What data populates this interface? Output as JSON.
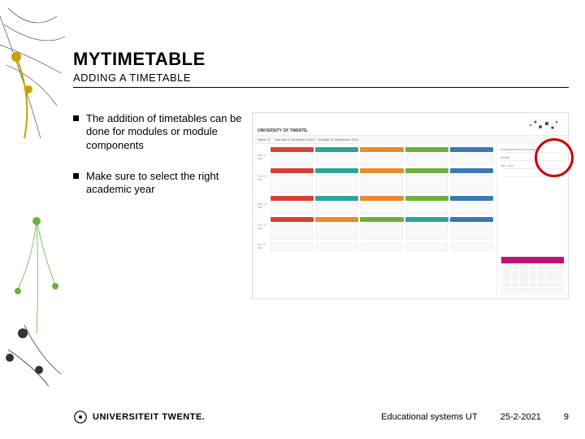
{
  "title": "MYTIMETABLE",
  "subtitle": "ADDING A TIMETABLE",
  "bullets": {
    "b1": "The addition of timetables can be done for modules or module components",
    "b2": "Make sure to select  the right academic year"
  },
  "screenshot": {
    "brand": "UNIVERSITY OF TWENTE.",
    "nav_week": "Week 37",
    "nav_range": "Monday 9 September 2013 – Sunday 15 September 2013",
    "days": [
      "Mon 9 Sep",
      "Tue 10 Sep",
      "Wed 11 Sep",
      "Thu 12 Sep",
      "Fri 13 Sep"
    ],
    "side": {
      "item1": "Moduleonderdeel toevoegen",
      "item2": "Module",
      "item3": "Vak / Zaal"
    },
    "colors": {
      "red": "#d64036",
      "teal": "#2fa39a",
      "orange": "#e88b2e",
      "green": "#6fae3e",
      "blue": "#3c77b3",
      "pink": "#c01075"
    }
  },
  "footer": {
    "org": "UNIVERSITEIT TWENTE.",
    "source": "Educational systems UT",
    "date": "25-2-2021",
    "page": "9"
  }
}
